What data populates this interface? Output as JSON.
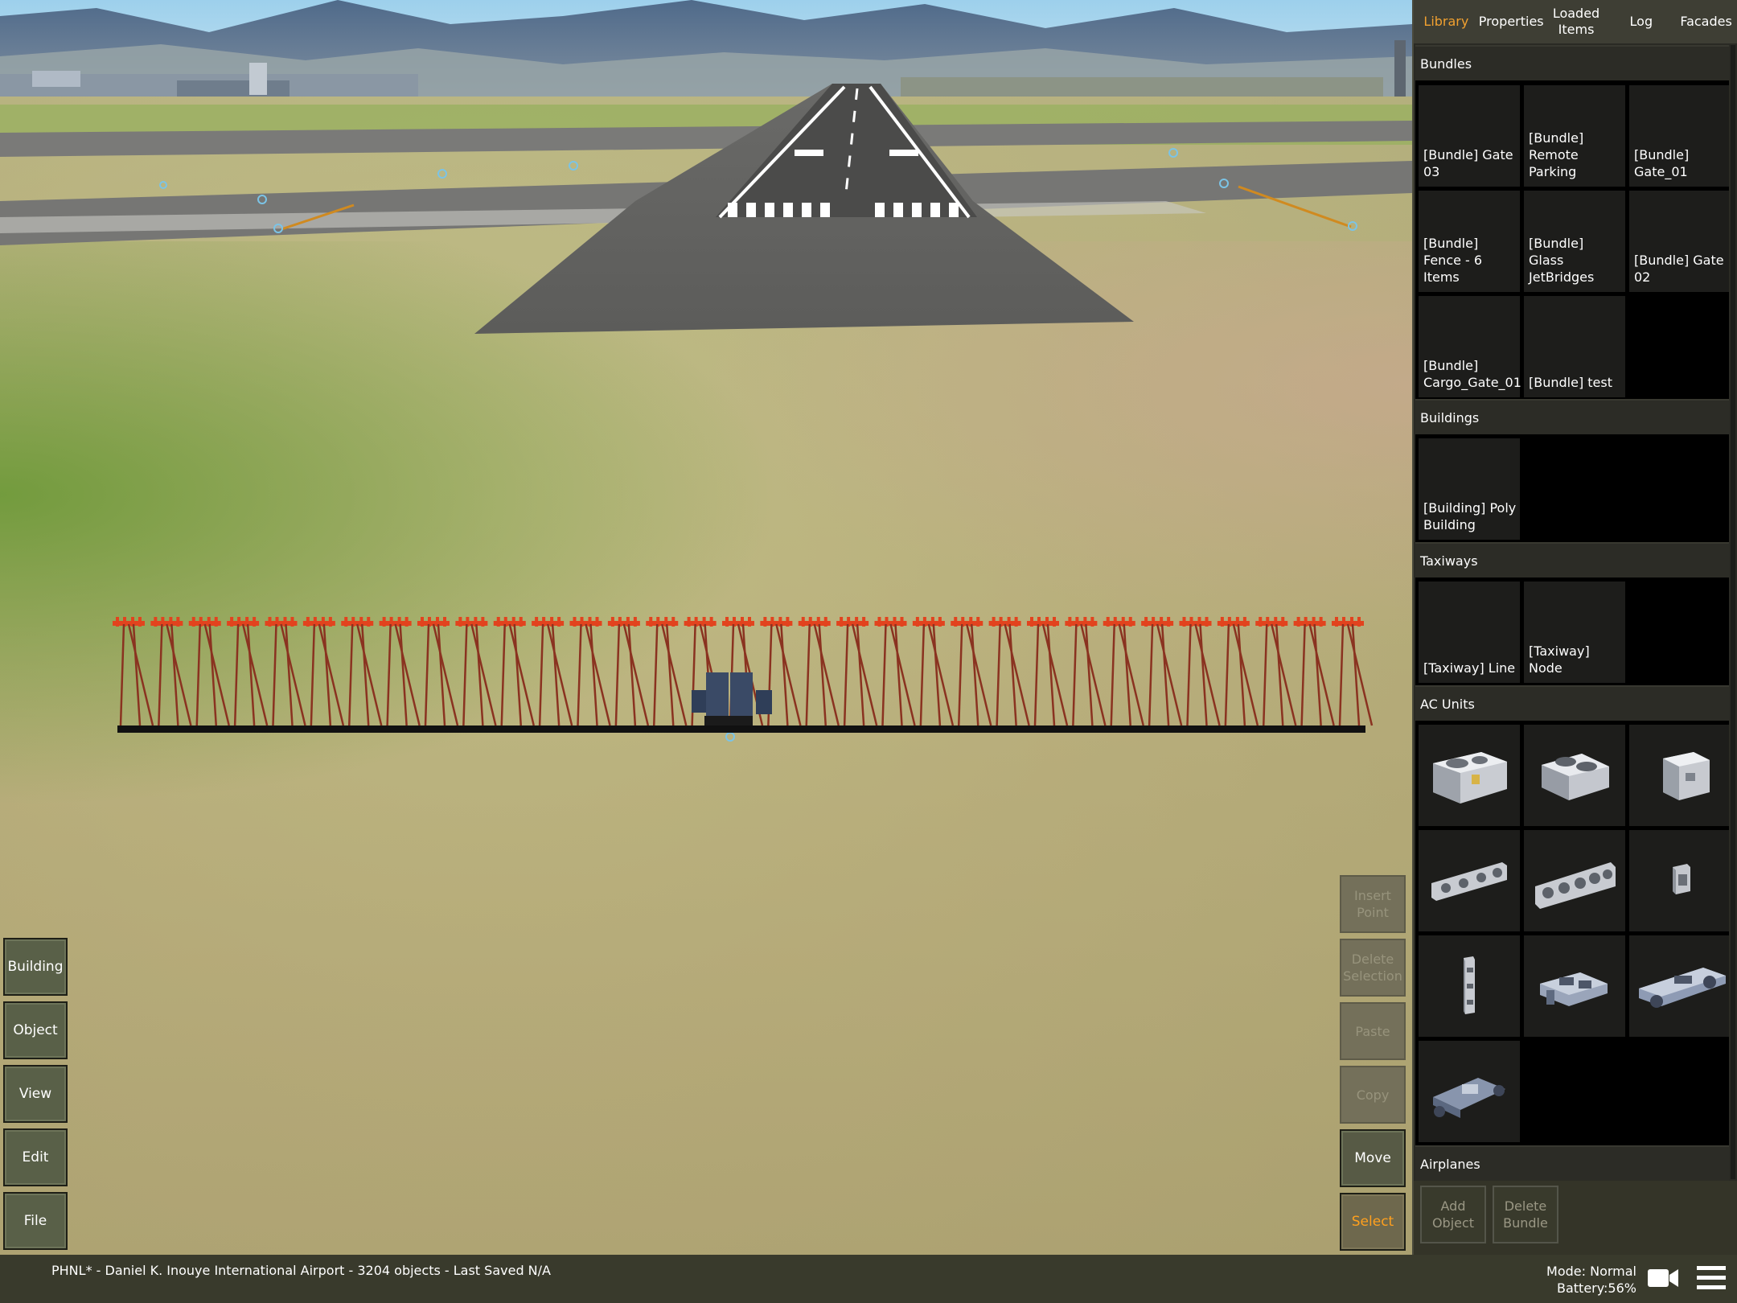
{
  "panel": {
    "tabs": [
      {
        "label": "Library",
        "active": true
      },
      {
        "label": "Properties",
        "active": false
      },
      {
        "label": "Loaded Items",
        "active": false
      },
      {
        "label": "Log",
        "active": false
      },
      {
        "label": "Facades",
        "active": false
      }
    ],
    "sections": {
      "bundles": {
        "title": "Bundles",
        "items": [
          "[Bundle] Gate 03",
          "[Bundle] Remote Parking",
          "[Bundle] Gate_01",
          "[Bundle] Fence - 6 Items",
          "[Bundle] Glass JetBridges",
          "[Bundle] Gate 02",
          "[Bundle] Cargo_Gate_01",
          "[Bundle] test"
        ]
      },
      "buildings": {
        "title": "Buildings",
        "items": [
          "[Building] Poly Building"
        ]
      },
      "taxiways": {
        "title": "Taxiways",
        "items": [
          "[Taxiway] Line",
          "[Taxiway] Node"
        ]
      },
      "ac_units": {
        "title": "AC Units",
        "items": [
          "ac-unit-large-icon",
          "ac-unit-double-fan-icon",
          "ac-unit-compact-icon",
          "ac-unit-row-4-icon",
          "ac-unit-row-5-icon",
          "ac-unit-wall-icon",
          "ac-unit-tower-icon",
          "ac-unit-rooftop-icon",
          "ac-unit-ducted-icon",
          "ac-unit-frame-icon"
        ]
      },
      "airplanes": {
        "title": "Airplanes"
      }
    },
    "actions": {
      "add_object": "Add Object",
      "delete_bundle": "Delete Bundle"
    }
  },
  "left_tools": [
    "Building",
    "Object",
    "View",
    "Edit",
    "File"
  ],
  "edit_tools": [
    {
      "label": "Insert Point",
      "state": "disabled"
    },
    {
      "label": "Delete Selection",
      "state": "disabled"
    },
    {
      "label": "Paste",
      "state": "disabled"
    },
    {
      "label": "Copy",
      "state": "disabled"
    },
    {
      "label": "Move",
      "state": "active"
    },
    {
      "label": "Select",
      "state": "selected"
    }
  ],
  "status": {
    "project": "PHNL* - Daniel K. Inouye International Airport - 3204 objects - Last Saved N/A",
    "mode": "Mode: Normal",
    "battery": "Battery:56%"
  },
  "colors": {
    "accent_orange": "#f0a030",
    "select_orange": "#ffa01e",
    "approach_lights": "#e2431e",
    "panel_bg": "#2a2a24"
  },
  "icons": {
    "camera": "camera-icon",
    "menu": "hamburger-menu-icon"
  }
}
